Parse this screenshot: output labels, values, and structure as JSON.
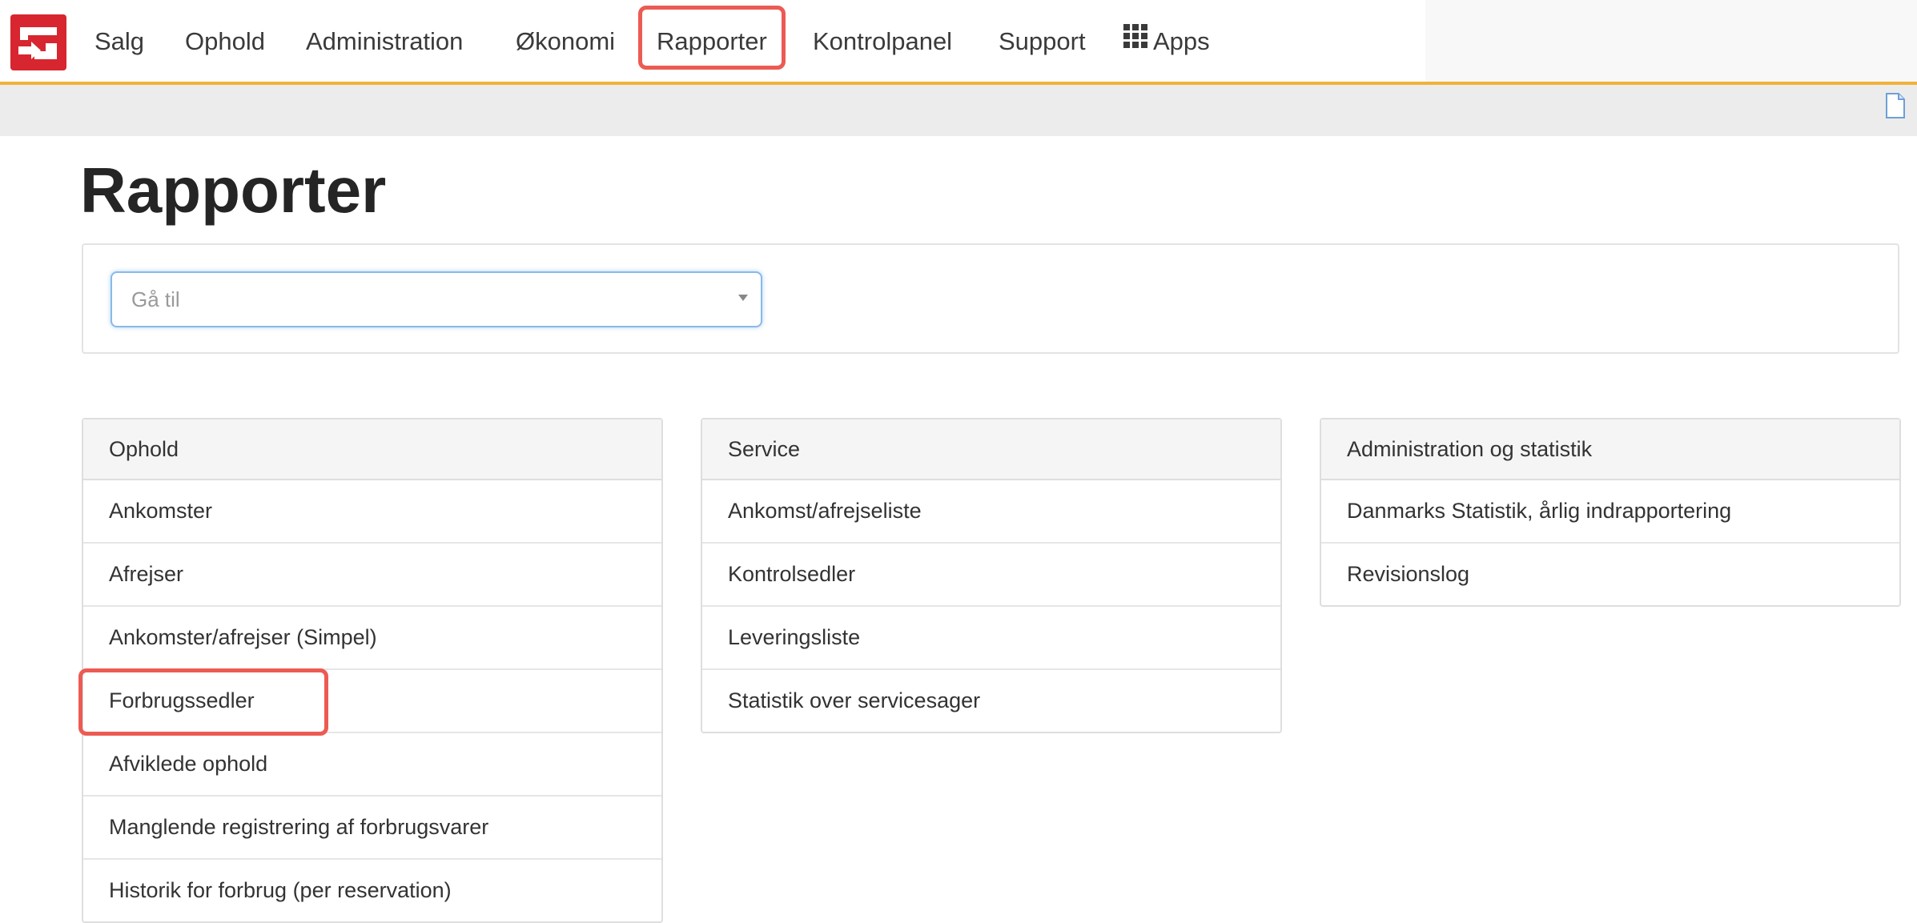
{
  "nav": {
    "logo": "logo-icon",
    "items": [
      "Salg",
      "Ophold",
      "Administration",
      "Økonomi",
      "Rapporter",
      "Kontrolpanel",
      "Support",
      "Apps"
    ],
    "highlighted": "Rapporter",
    "apps_icon": "grid-icon"
  },
  "toolbar": {
    "doc_icon": "document-icon"
  },
  "page": {
    "title": "Rapporter"
  },
  "goto": {
    "placeholder": "Gå til"
  },
  "panels": [
    {
      "title": "Ophold",
      "items": [
        "Ankomster",
        "Afrejser",
        "Ankomster/afrejser (Simpel)",
        "Forbrugssedler",
        "Afviklede ophold",
        "Manglende registrering af forbrugsvarer",
        "Historik for forbrug (per reservation)"
      ]
    },
    {
      "title": "Service",
      "items": [
        "Ankomst/afrejseliste",
        "Kontrolsedler",
        "Leveringsliste",
        "Statistik over servicesager"
      ]
    },
    {
      "title": "Administration og statistik",
      "items": [
        "Danmarks Statistik, årlig indrapportering",
        "Revisionslog"
      ]
    }
  ],
  "highlights": {
    "panel_item": "Forbrugssedler",
    "highlight_color": "#ec5b53"
  },
  "colors": {
    "accent_border": "#f0b239",
    "logo": "#d7262f"
  }
}
